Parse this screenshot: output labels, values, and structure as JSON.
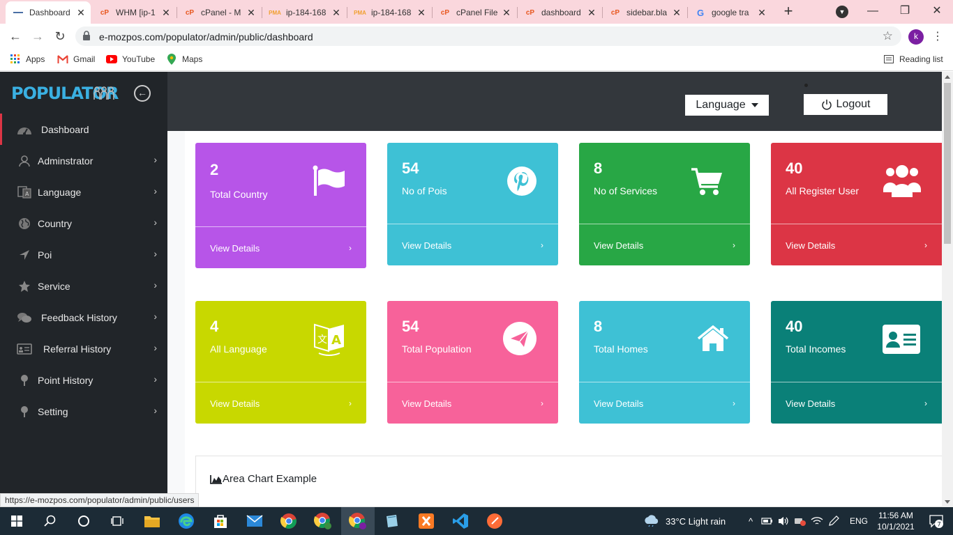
{
  "browser": {
    "tabs": [
      {
        "title": "Dashboard",
        "favicon": "minus-icon",
        "active": true
      },
      {
        "title": "WHM [ip-1",
        "favicon": "cpanel-icon",
        "active": false
      },
      {
        "title": "cPanel - M",
        "favicon": "cpanel-icon",
        "active": false
      },
      {
        "title": "ip-184-168",
        "favicon": "phpmyadmin-icon",
        "active": false
      },
      {
        "title": "ip-184-168",
        "favicon": "phpmyadmin-icon",
        "active": false
      },
      {
        "title": "cPanel File",
        "favicon": "cpanel-icon",
        "active": false
      },
      {
        "title": "dashboard",
        "favicon": "cpanel-icon",
        "active": false
      },
      {
        "title": "sidebar.bla",
        "favicon": "cpanel-icon",
        "active": false
      },
      {
        "title": "google tra",
        "favicon": "google-icon",
        "active": false
      }
    ],
    "new_tab": "+",
    "url": "e-mozpos.com/populator/admin/public/dashboard",
    "profile_initial": "k",
    "bookmarks": [
      {
        "label": "Apps"
      },
      {
        "label": "Gmail"
      },
      {
        "label": "YouTube"
      },
      {
        "label": "Maps"
      }
    ],
    "reading_list": "Reading list",
    "status_url": "https://e-mozpos.com/populator/admin/public/users"
  },
  "app": {
    "logo_text": "POPULATOR",
    "sidebar": [
      {
        "label": "Dashboard",
        "icon": "tachometer-icon",
        "active": true,
        "chevron": false
      },
      {
        "label": "Adminstrator",
        "icon": "user-icon",
        "active": false,
        "chevron": true
      },
      {
        "label": "Language",
        "icon": "language-icon",
        "active": false,
        "chevron": true
      },
      {
        "label": "Country",
        "icon": "globe-icon",
        "active": false,
        "chevron": true
      },
      {
        "label": "Poi",
        "icon": "location-arrow-icon",
        "active": false,
        "chevron": true
      },
      {
        "label": "Service",
        "icon": "star-icon",
        "active": false,
        "chevron": true
      },
      {
        "label": "Feedback History",
        "icon": "comments-icon",
        "active": false,
        "chevron": true
      },
      {
        "label": "Referral History",
        "icon": "id-card-icon",
        "active": false,
        "chevron": true
      },
      {
        "label": "Point History",
        "icon": "map-pin-icon",
        "active": false,
        "chevron": true
      },
      {
        "label": "Setting",
        "icon": "pin-icon",
        "active": false,
        "chevron": true
      }
    ],
    "header": {
      "language_label": "Language",
      "logout_label": "Logout"
    },
    "cards": [
      {
        "value": "2",
        "label": "Total Country",
        "icon": "flag-icon",
        "color": "#b755e8",
        "footer": "View Details"
      },
      {
        "value": "54",
        "label": "No of Pois",
        "icon": "pinterest-icon",
        "color": "#3ec1d5",
        "footer": "View Details"
      },
      {
        "value": "8",
        "label": "No of Services",
        "icon": "shopping-cart-icon",
        "color": "#28a745",
        "footer": "View Details"
      },
      {
        "value": "40",
        "label": "All Register User",
        "icon": "users-icon",
        "color": "#dc3545",
        "footer": "View Details"
      },
      {
        "value": "4",
        "label": "All Language",
        "icon": "translate-icon",
        "color": "#c8d800",
        "footer": "View Details"
      },
      {
        "value": "54",
        "label": "Total Population",
        "icon": "paper-plane-icon",
        "color": "#f7629a",
        "footer": "View Details"
      },
      {
        "value": "8",
        "label": "Total Homes",
        "icon": "home-icon",
        "color": "#3ec1d5",
        "footer": "View Details"
      },
      {
        "value": "40",
        "label": "Total Incomes",
        "icon": "address-card-icon",
        "color": "#0a8078",
        "footer": "View Details"
      }
    ],
    "chart_title": "Area Chart Example"
  },
  "taskbar": {
    "weather": "33°C  Light rain",
    "lang": "ENG",
    "time": "11:56 AM",
    "date": "10/1/2021",
    "notifications": "7"
  }
}
